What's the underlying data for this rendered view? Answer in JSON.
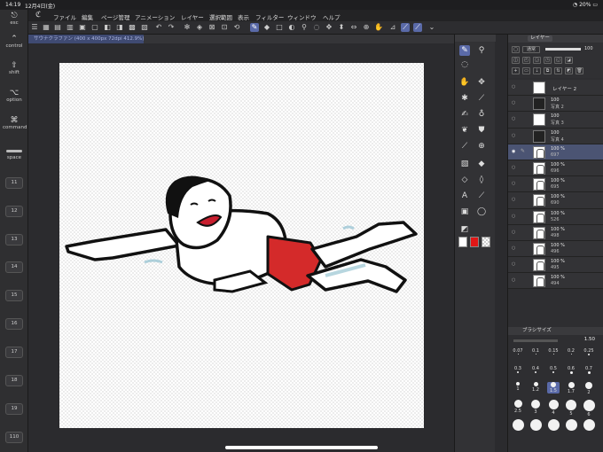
{
  "status": {
    "time": "14:19",
    "date": "12月4日(金)",
    "battery": "20%"
  },
  "keys": {
    "esc": "esc",
    "control": "control",
    "shift": "shift",
    "option": "option",
    "command": "command",
    "space": "space",
    "fkeys": [
      "11",
      "12",
      "13",
      "14",
      "15",
      "16",
      "17",
      "18",
      "19",
      "110"
    ]
  },
  "menu": [
    "ファイル",
    "編集",
    "ページ管理",
    "アニメーション",
    "レイヤー",
    "選択範囲",
    "表示",
    "フィルター",
    "ウィンドウ",
    "ヘルプ"
  ],
  "document": {
    "tab_title": "サウナクラファン (400 x 400px 72dpi 412.9%)"
  },
  "layers": {
    "panel_title": "レイヤー",
    "blend_mode": "通常",
    "opacity": "100",
    "items": [
      {
        "name": "レイヤー 2",
        "opacity": "",
        "label": "",
        "type": "plain"
      },
      {
        "name": "",
        "opacity": "100",
        "label": "写真 2",
        "type": "photo"
      },
      {
        "name": "",
        "opacity": "100",
        "label": "写真 3",
        "type": "photo"
      },
      {
        "name": "",
        "opacity": "100",
        "label": "写真 4",
        "type": "photo"
      },
      {
        "name": "",
        "opacity": "100 %",
        "label": "697",
        "type": "frame",
        "selected": true
      },
      {
        "name": "",
        "opacity": "100 %",
        "label": "696",
        "type": "frame"
      },
      {
        "name": "",
        "opacity": "100 %",
        "label": "695",
        "type": "frame"
      },
      {
        "name": "",
        "opacity": "100 %",
        "label": "690",
        "type": "frame"
      },
      {
        "name": "",
        "opacity": "100 %",
        "label": "526",
        "type": "frame"
      },
      {
        "name": "",
        "opacity": "100 %",
        "label": "498",
        "type": "frame"
      },
      {
        "name": "",
        "opacity": "100 %",
        "label": "496",
        "type": "frame"
      },
      {
        "name": "",
        "opacity": "100 %",
        "label": "495",
        "type": "frame"
      },
      {
        "name": "",
        "opacity": "100 %",
        "label": "494",
        "type": "frame"
      }
    ]
  },
  "brush": {
    "panel_title": "ブラシサイズ",
    "current_size": "1.50",
    "row1": [
      "0.07",
      "0.1",
      "0.15",
      "0.2",
      "0.25"
    ],
    "row2": [
      "0.3",
      "0.4",
      "0.5",
      "0.6",
      "0.7"
    ],
    "row3": [
      "1",
      "1.2",
      "1.5",
      "1.7",
      "2"
    ],
    "row4": [
      "2.5",
      "3",
      "4",
      "5",
      "6"
    ]
  }
}
